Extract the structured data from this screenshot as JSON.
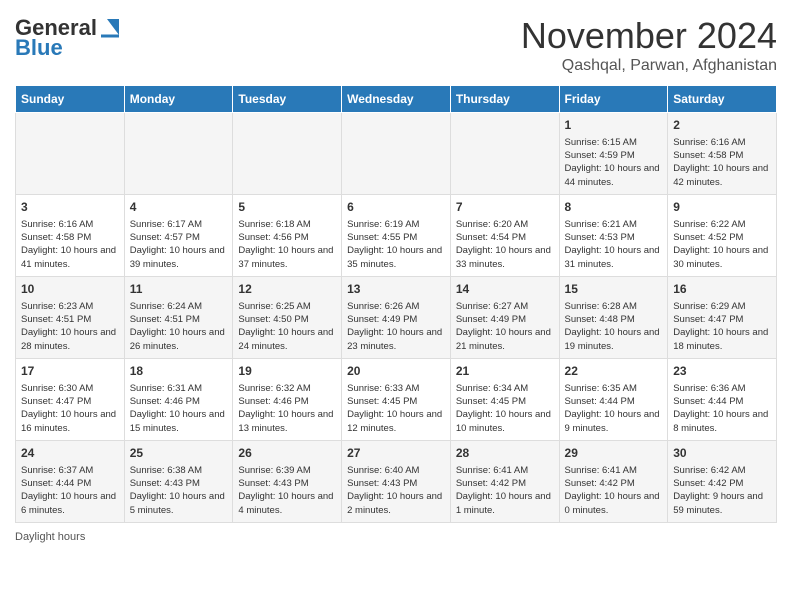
{
  "header": {
    "logo_general": "General",
    "logo_blue": "Blue",
    "month": "November 2024",
    "location": "Qashqal, Parwan, Afghanistan"
  },
  "weekdays": [
    "Sunday",
    "Monday",
    "Tuesday",
    "Wednesday",
    "Thursday",
    "Friday",
    "Saturday"
  ],
  "weeks": [
    [
      {
        "day": "",
        "info": ""
      },
      {
        "day": "",
        "info": ""
      },
      {
        "day": "",
        "info": ""
      },
      {
        "day": "",
        "info": ""
      },
      {
        "day": "",
        "info": ""
      },
      {
        "day": "1",
        "info": "Sunrise: 6:15 AM\nSunset: 4:59 PM\nDaylight: 10 hours and 44 minutes."
      },
      {
        "day": "2",
        "info": "Sunrise: 6:16 AM\nSunset: 4:58 PM\nDaylight: 10 hours and 42 minutes."
      }
    ],
    [
      {
        "day": "3",
        "info": "Sunrise: 6:16 AM\nSunset: 4:58 PM\nDaylight: 10 hours and 41 minutes."
      },
      {
        "day": "4",
        "info": "Sunrise: 6:17 AM\nSunset: 4:57 PM\nDaylight: 10 hours and 39 minutes."
      },
      {
        "day": "5",
        "info": "Sunrise: 6:18 AM\nSunset: 4:56 PM\nDaylight: 10 hours and 37 minutes."
      },
      {
        "day": "6",
        "info": "Sunrise: 6:19 AM\nSunset: 4:55 PM\nDaylight: 10 hours and 35 minutes."
      },
      {
        "day": "7",
        "info": "Sunrise: 6:20 AM\nSunset: 4:54 PM\nDaylight: 10 hours and 33 minutes."
      },
      {
        "day": "8",
        "info": "Sunrise: 6:21 AM\nSunset: 4:53 PM\nDaylight: 10 hours and 31 minutes."
      },
      {
        "day": "9",
        "info": "Sunrise: 6:22 AM\nSunset: 4:52 PM\nDaylight: 10 hours and 30 minutes."
      }
    ],
    [
      {
        "day": "10",
        "info": "Sunrise: 6:23 AM\nSunset: 4:51 PM\nDaylight: 10 hours and 28 minutes."
      },
      {
        "day": "11",
        "info": "Sunrise: 6:24 AM\nSunset: 4:51 PM\nDaylight: 10 hours and 26 minutes."
      },
      {
        "day": "12",
        "info": "Sunrise: 6:25 AM\nSunset: 4:50 PM\nDaylight: 10 hours and 24 minutes."
      },
      {
        "day": "13",
        "info": "Sunrise: 6:26 AM\nSunset: 4:49 PM\nDaylight: 10 hours and 23 minutes."
      },
      {
        "day": "14",
        "info": "Sunrise: 6:27 AM\nSunset: 4:49 PM\nDaylight: 10 hours and 21 minutes."
      },
      {
        "day": "15",
        "info": "Sunrise: 6:28 AM\nSunset: 4:48 PM\nDaylight: 10 hours and 19 minutes."
      },
      {
        "day": "16",
        "info": "Sunrise: 6:29 AM\nSunset: 4:47 PM\nDaylight: 10 hours and 18 minutes."
      }
    ],
    [
      {
        "day": "17",
        "info": "Sunrise: 6:30 AM\nSunset: 4:47 PM\nDaylight: 10 hours and 16 minutes."
      },
      {
        "day": "18",
        "info": "Sunrise: 6:31 AM\nSunset: 4:46 PM\nDaylight: 10 hours and 15 minutes."
      },
      {
        "day": "19",
        "info": "Sunrise: 6:32 AM\nSunset: 4:46 PM\nDaylight: 10 hours and 13 minutes."
      },
      {
        "day": "20",
        "info": "Sunrise: 6:33 AM\nSunset: 4:45 PM\nDaylight: 10 hours and 12 minutes."
      },
      {
        "day": "21",
        "info": "Sunrise: 6:34 AM\nSunset: 4:45 PM\nDaylight: 10 hours and 10 minutes."
      },
      {
        "day": "22",
        "info": "Sunrise: 6:35 AM\nSunset: 4:44 PM\nDaylight: 10 hours and 9 minutes."
      },
      {
        "day": "23",
        "info": "Sunrise: 6:36 AM\nSunset: 4:44 PM\nDaylight: 10 hours and 8 minutes."
      }
    ],
    [
      {
        "day": "24",
        "info": "Sunrise: 6:37 AM\nSunset: 4:44 PM\nDaylight: 10 hours and 6 minutes."
      },
      {
        "day": "25",
        "info": "Sunrise: 6:38 AM\nSunset: 4:43 PM\nDaylight: 10 hours and 5 minutes."
      },
      {
        "day": "26",
        "info": "Sunrise: 6:39 AM\nSunset: 4:43 PM\nDaylight: 10 hours and 4 minutes."
      },
      {
        "day": "27",
        "info": "Sunrise: 6:40 AM\nSunset: 4:43 PM\nDaylight: 10 hours and 2 minutes."
      },
      {
        "day": "28",
        "info": "Sunrise: 6:41 AM\nSunset: 4:42 PM\nDaylight: 10 hours and 1 minute."
      },
      {
        "day": "29",
        "info": "Sunrise: 6:41 AM\nSunset: 4:42 PM\nDaylight: 10 hours and 0 minutes."
      },
      {
        "day": "30",
        "info": "Sunrise: 6:42 AM\nSunset: 4:42 PM\nDaylight: 9 hours and 59 minutes."
      }
    ]
  ],
  "footer": {
    "daylight_label": "Daylight hours"
  }
}
